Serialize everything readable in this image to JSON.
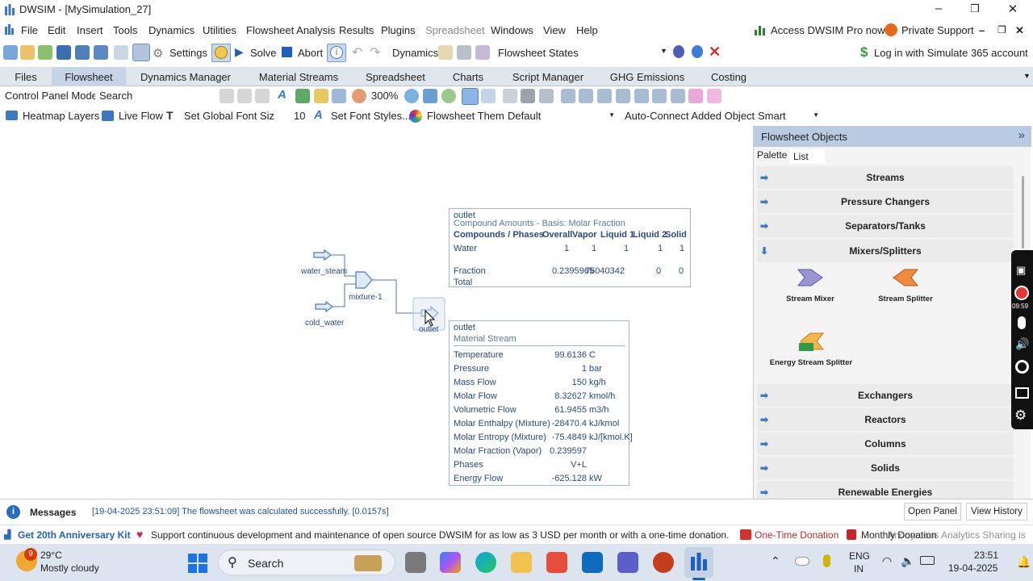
{
  "window": {
    "title": "DWSIM - [MySimulation_27]"
  },
  "menu": [
    "File",
    "Edit",
    "Insert",
    "Tools",
    "Dynamics",
    "Utilities",
    "Flowsheet Analysis",
    "Results",
    "Plugins",
    "Spreadsheet",
    "Windows",
    "View",
    "Help"
  ],
  "menu_right": {
    "pro": "Access DWSIM Pro now",
    "support": "Private Support"
  },
  "toolbar": {
    "settings": "Settings",
    "solve": "Solve",
    "abort": "Abort",
    "dynamics": "Dynamics",
    "flowsheet_states": "Flowsheet States",
    "login": "Log in with Simulate 365 account"
  },
  "tabs": [
    "Files",
    "Flowsheet",
    "Dynamics Manager",
    "Material Streams",
    "Spreadsheet",
    "Charts",
    "Script Manager",
    "GHG Emissions",
    "Costing"
  ],
  "tb3": {
    "mode": "Control Panel Mode",
    "search": "Search",
    "zoom": "300%"
  },
  "tb4": {
    "heatmap": "Heatmap Layers",
    "liveflow": "Live Flow",
    "globalfont": "Set Global Font Size",
    "fontsize": "10",
    "fontstyles": "Set Font Styles...",
    "theme_label": "Flowsheet Theme",
    "theme": "Default",
    "autoconnect": "Auto-Connect Added Objects",
    "smart": "Smart"
  },
  "flowsheet": {
    "streams": {
      "water_steam": "water_steam",
      "cold_water": "cold_water",
      "mixture": "mixture-1",
      "outlet": "outlet"
    },
    "compound_box": {
      "title": "outlet",
      "subtitle": "Compound Amounts - Basis: Molar Fraction",
      "headers": [
        "Compounds / Phases",
        "Overall",
        "Vapor",
        "Liquid 1",
        "Liquid 2",
        "Solid"
      ],
      "rows": [
        {
          "name": "Water",
          "vals": [
            "1",
            "1",
            "1",
            "1",
            "1"
          ]
        },
        {
          "name": "Fraction",
          "vals": [
            "0.2395965",
            "76040342",
            "",
            "0",
            "0"
          ]
        },
        {
          "name": "Total",
          "vals": [
            "",
            "",
            "",
            "",
            ""
          ]
        }
      ]
    },
    "material_box": {
      "title": "outlet",
      "subtitle": "Material Stream",
      "rows": [
        {
          "k": "Temperature",
          "v": "99.6136",
          "u": "C"
        },
        {
          "k": "Pressure",
          "v": "1",
          "u": "bar"
        },
        {
          "k": "Mass Flow",
          "v": "150",
          "u": "kg/h"
        },
        {
          "k": "Molar Flow",
          "v": "8.32627",
          "u": "kmol/h"
        },
        {
          "k": "Volumetric Flow",
          "v": "61.9455",
          "u": "m3/h"
        },
        {
          "k": "Molar Enthalpy (Mixture)",
          "v": "-28470.4",
          "u": "kJ/kmol"
        },
        {
          "k": "Molar Entropy (Mixture)",
          "v": "-75.4849",
          "u": "kJ/[kmol.K]"
        },
        {
          "k": "Molar Fraction (Vapor)",
          "v": "0.239597",
          "u": ""
        },
        {
          "k": "Phases",
          "v": "V+L",
          "u": ""
        },
        {
          "k": "Energy Flow",
          "v": "-625.128",
          "u": "kW"
        }
      ]
    }
  },
  "panel": {
    "title": "Flowsheet Objects",
    "tab_palette": "Palette",
    "tab_list": "List",
    "cats_top": [
      "Streams",
      "Pressure Changers",
      "Separators/Tanks",
      "Mixers/Splitters"
    ],
    "items": [
      "Stream Mixer",
      "Stream Splitter",
      "Energy Stream Splitter"
    ],
    "cats_bottom": [
      "Exchangers",
      "Reactors",
      "Columns",
      "Solids",
      "Renewable Energies"
    ]
  },
  "messages": {
    "label": "Messages",
    "text": "[19-04-2025 23:51:09] The flowsheet was calculated successfully. [0.0157s]",
    "open": "Open Panel",
    "history": "View History"
  },
  "donate": {
    "kit": "Get 20th Anniversary Kit",
    "text": "Support continuous development and maintenance of open source DWSIM for as low as 3 USD per month or with a one-time donation.",
    "one": "One-Time Donation",
    "monthly": "Monthly Donation",
    "analytics": "Anonymous Analytics Sharing is ON"
  },
  "rec": {
    "time": "09:59"
  },
  "taskbar": {
    "badge": "9",
    "temp": "29°C",
    "weather": "Mostly cloudy",
    "search": "Search",
    "lang1": "ENG",
    "lang2": "IN",
    "time": "23:51",
    "date": "19-04-2025"
  },
  "colors": {
    "accent": "#3a78c2",
    "tab_active": "#c5d4e6",
    "panel_header": "#b9cbe0",
    "taskbar": "#dce4ef"
  }
}
